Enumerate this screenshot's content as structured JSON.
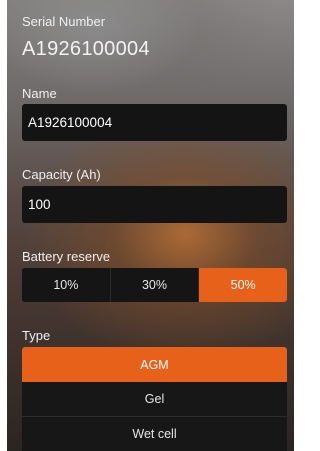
{
  "serial": {
    "label": "Serial Number",
    "value": "A1926100004"
  },
  "name": {
    "label": "Name",
    "value": "A1926100004"
  },
  "capacity": {
    "label": "Capacity (Ah)",
    "value": "100"
  },
  "reserve": {
    "label": "Battery reserve",
    "options": [
      "10%",
      "30%",
      "50%"
    ],
    "selected": "50%"
  },
  "type": {
    "label": "Type",
    "options": [
      "AGM",
      "Gel",
      "Wet cell"
    ],
    "selected": "AGM"
  },
  "colors": {
    "accent": "#e8611a",
    "field_bg": "#141414"
  }
}
